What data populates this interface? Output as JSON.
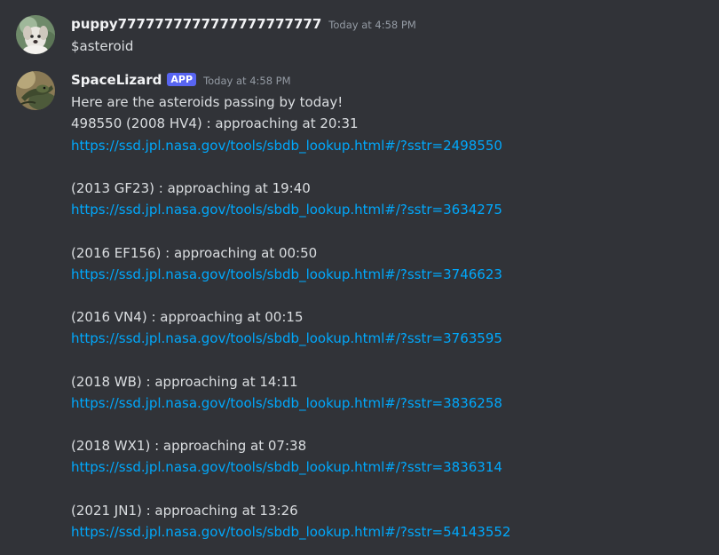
{
  "messages": [
    {
      "username": "puppy7777777777777777777777",
      "timestamp": "Today at 4:58 PM",
      "text": "$asteroid"
    },
    {
      "username": "SpaceLizard",
      "badge": "APP",
      "timestamp": "Today at 4:58 PM",
      "intro": "Here are the asteroids passing by today!",
      "asteroids": [
        {
          "name": "498550 (2008 HV4) : approaching at 20:31",
          "url": "https://ssd.jpl.nasa.gov/tools/sbdb_lookup.html#/?sstr=2498550"
        },
        {
          "name": "(2013 GF23) : approaching at 19:40",
          "url": "https://ssd.jpl.nasa.gov/tools/sbdb_lookup.html#/?sstr=3634275"
        },
        {
          "name": "(2016 EF156) : approaching at 00:50",
          "url": "https://ssd.jpl.nasa.gov/tools/sbdb_lookup.html#/?sstr=3746623"
        },
        {
          "name": "(2016 VN4) : approaching at 00:15",
          "url": "https://ssd.jpl.nasa.gov/tools/sbdb_lookup.html#/?sstr=3763595"
        },
        {
          "name": "(2018 WB) : approaching at 14:11",
          "url": "https://ssd.jpl.nasa.gov/tools/sbdb_lookup.html#/?sstr=3836258"
        },
        {
          "name": "(2018 WX1) : approaching at 07:38",
          "url": "https://ssd.jpl.nasa.gov/tools/sbdb_lookup.html#/?sstr=3836314"
        },
        {
          "name": "(2021 JN1) : approaching at 13:26",
          "url": "https://ssd.jpl.nasa.gov/tools/sbdb_lookup.html#/?sstr=54143552"
        }
      ]
    }
  ],
  "colors": {
    "background": "#313338",
    "username": "#f2f3f5",
    "text": "#dbdee1",
    "timestamp": "#949ba4",
    "link": "#00a8fc",
    "badge": "#5865f2"
  },
  "icons": {
    "user_avatar": "puppy-avatar-icon",
    "bot_avatar": "lizard-avatar-icon"
  }
}
